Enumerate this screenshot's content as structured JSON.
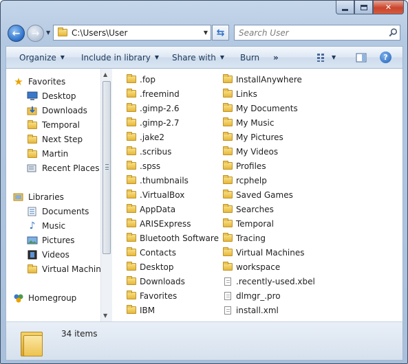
{
  "window": {
    "caption_buttons": [
      "minimize",
      "maximize",
      "close"
    ]
  },
  "address_bar": {
    "path": "C:\\Users\\User"
  },
  "search": {
    "placeholder": "Search User"
  },
  "toolbar": {
    "organize": "Organize",
    "include_in_library": "Include in library",
    "share_with": "Share with",
    "burn": "Burn",
    "more": "»"
  },
  "nav": {
    "favorites": {
      "title": "Favorites",
      "items": [
        {
          "label": "Desktop",
          "icon": "desktop-icon"
        },
        {
          "label": "Downloads",
          "icon": "downloads-icon"
        },
        {
          "label": "Temporal",
          "icon": "folder-icon"
        },
        {
          "label": "Next Step",
          "icon": "folder-icon"
        },
        {
          "label": "Martin",
          "icon": "folder-icon"
        },
        {
          "label": "Recent Places",
          "icon": "recent-places-icon"
        }
      ]
    },
    "libraries": {
      "title": "Libraries",
      "items": [
        {
          "label": "Documents",
          "icon": "documents-icon"
        },
        {
          "label": "Music",
          "icon": "music-icon"
        },
        {
          "label": "Pictures",
          "icon": "pictures-icon"
        },
        {
          "label": "Videos",
          "icon": "videos-icon"
        },
        {
          "label": "Virtual Machines",
          "icon": "folder-icon"
        }
      ]
    },
    "homegroup": {
      "title": "Homegroup"
    }
  },
  "files": {
    "column1": [
      {
        "name": ".fop",
        "type": "folder"
      },
      {
        "name": ".freemind",
        "type": "folder"
      },
      {
        "name": ".gimp-2.6",
        "type": "folder"
      },
      {
        "name": ".gimp-2.7",
        "type": "folder"
      },
      {
        "name": ".jake2",
        "type": "folder"
      },
      {
        "name": ".scribus",
        "type": "folder"
      },
      {
        "name": ".spss",
        "type": "folder"
      },
      {
        "name": ".thumbnails",
        "type": "folder"
      },
      {
        "name": ".VirtualBox",
        "type": "folder"
      },
      {
        "name": "AppData",
        "type": "folder"
      },
      {
        "name": "ARISExpress",
        "type": "folder"
      },
      {
        "name": "Bluetooth Software",
        "type": "folder"
      },
      {
        "name": "Contacts",
        "type": "folder"
      },
      {
        "name": "Desktop",
        "type": "folder"
      },
      {
        "name": "Downloads",
        "type": "folder"
      },
      {
        "name": "Favorites",
        "type": "folder"
      },
      {
        "name": "IBM",
        "type": "folder"
      }
    ],
    "column2": [
      {
        "name": "InstallAnywhere",
        "type": "folder"
      },
      {
        "name": "Links",
        "type": "folder"
      },
      {
        "name": "My Documents",
        "type": "folder"
      },
      {
        "name": "My Music",
        "type": "folder"
      },
      {
        "name": "My Pictures",
        "type": "folder"
      },
      {
        "name": "My Videos",
        "type": "folder"
      },
      {
        "name": "Profiles",
        "type": "folder"
      },
      {
        "name": "rcphelp",
        "type": "folder"
      },
      {
        "name": "Saved Games",
        "type": "folder"
      },
      {
        "name": "Searches",
        "type": "folder"
      },
      {
        "name": "Temporal",
        "type": "folder"
      },
      {
        "name": "Tracing",
        "type": "folder"
      },
      {
        "name": "Virtual Machines",
        "type": "folder"
      },
      {
        "name": "workspace",
        "type": "folder"
      },
      {
        "name": ".recently-used.xbel",
        "type": "file"
      },
      {
        "name": "dlmgr_.pro",
        "type": "file"
      },
      {
        "name": "install.xml",
        "type": "file"
      }
    ]
  },
  "status_bar": {
    "item_count": "34 items"
  },
  "colors": {
    "chrome": "#b3c8e1",
    "folder": "#e6b83a",
    "accent": "#2b6fc9"
  }
}
